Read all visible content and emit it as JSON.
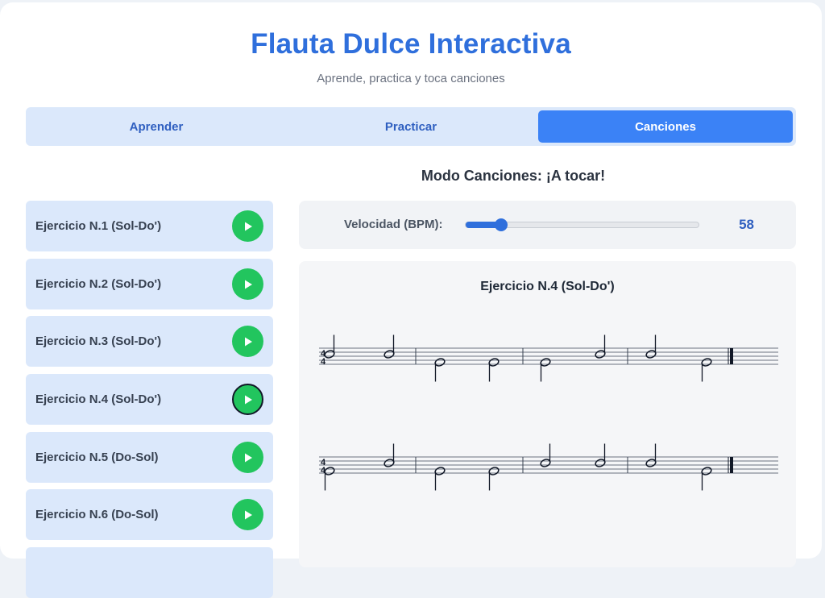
{
  "header": {
    "title": "Flauta Dulce Interactiva",
    "subtitle": "Aprende, practica y toca canciones"
  },
  "tabs": [
    {
      "label": "Aprender",
      "active": false
    },
    {
      "label": "Practicar",
      "active": false
    },
    {
      "label": "Canciones",
      "active": true
    }
  ],
  "mode_title": "Modo Canciones: ¡A tocar!",
  "songs": [
    {
      "label": "Ejercicio N.1 (Sol-Do')",
      "selected": false
    },
    {
      "label": "Ejercicio N.2 (Sol-Do')",
      "selected": false
    },
    {
      "label": "Ejercicio N.3 (Sol-Do')",
      "selected": false
    },
    {
      "label": "Ejercicio N.4 (Sol-Do')",
      "selected": true
    },
    {
      "label": "Ejercicio N.5 (Do-Sol)",
      "selected": false
    },
    {
      "label": "Ejercicio N.6 (Do-Sol)",
      "selected": false
    }
  ],
  "speed": {
    "label": "Velocidad (BPM):",
    "value": "58",
    "fraction": 0.15
  },
  "score": {
    "title": "Ejercicio N.4 (Sol-Do')",
    "time_signature": [
      "4",
      "4"
    ],
    "staves": [
      {
        "measures": [
          [
            "C5",
            "C5"
          ],
          [
            "G4",
            "G4"
          ],
          [
            "G4",
            "C5"
          ],
          [
            "C5",
            "G4"
          ]
        ]
      },
      {
        "measures": [
          [
            "G4",
            "C5"
          ],
          [
            "G4",
            "G4"
          ],
          [
            "C5",
            "C5"
          ],
          [
            "C5",
            "G4"
          ]
        ]
      }
    ]
  },
  "colors": {
    "accent": "#2f6fdc",
    "tab_active": "#3b82f6",
    "play": "#22c55e",
    "item_bg": "#dbe8fb"
  },
  "icons": {
    "play": "play-icon"
  }
}
